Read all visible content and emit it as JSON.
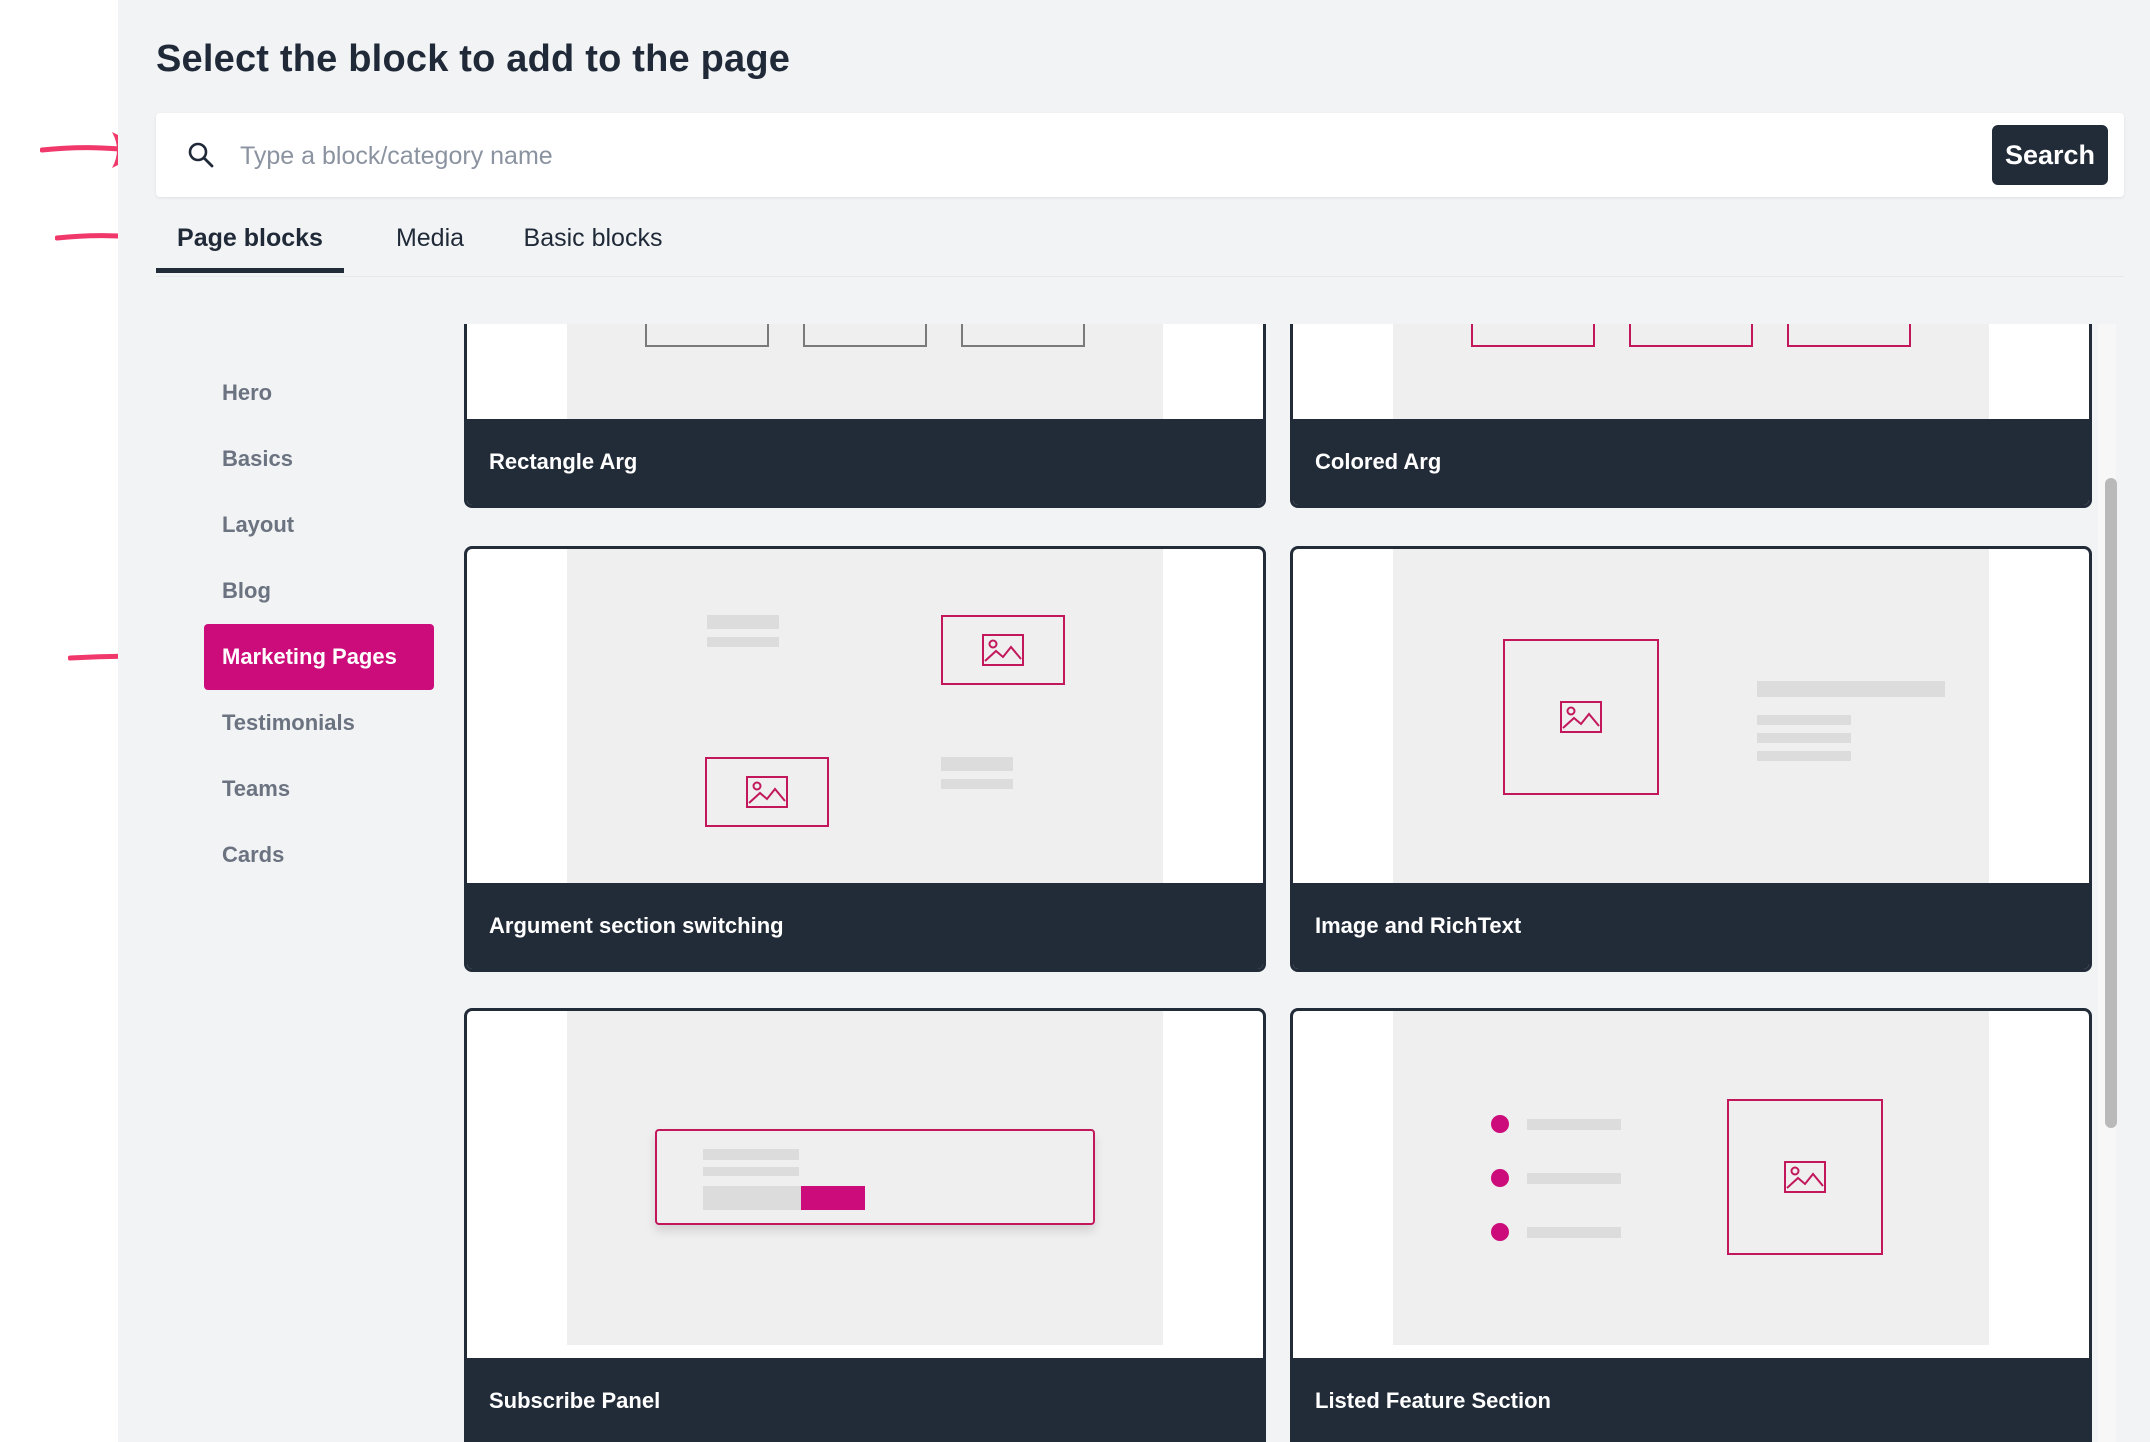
{
  "dialog": {
    "title": "Select the block to add to the page"
  },
  "search": {
    "placeholder": "Type a block/category name",
    "value": "",
    "button_label": "Search"
  },
  "tabs": [
    {
      "label": "Page blocks",
      "active": true
    },
    {
      "label": "Media",
      "active": false
    },
    {
      "label": "Basic blocks",
      "active": false
    }
  ],
  "sidebar": {
    "items": [
      {
        "label": "Hero",
        "active": false
      },
      {
        "label": "Basics",
        "active": false
      },
      {
        "label": "Layout",
        "active": false
      },
      {
        "label": "Blog",
        "active": false
      },
      {
        "label": "Marketing Pages",
        "active": true
      },
      {
        "label": "Testimonials",
        "active": false
      },
      {
        "label": "Teams",
        "active": false
      },
      {
        "label": "Cards",
        "active": false
      }
    ]
  },
  "cards": [
    {
      "label": "Rectangle Arg"
    },
    {
      "label": "Colored Arg"
    },
    {
      "label": "Argument section switching"
    },
    {
      "label": "Image and RichText"
    },
    {
      "label": "Subscribe Panel"
    },
    {
      "label": "Listed Feature Section"
    }
  ],
  "colors": {
    "accent": "#cc0c7a",
    "dark": "#222b38",
    "annotation_arrow": "#f0386b",
    "panel_background": "#f2f3f5"
  },
  "icons": {
    "search": "search-icon",
    "image_placeholder": "image-icon",
    "annotation": "annotation-arrow-icon"
  }
}
